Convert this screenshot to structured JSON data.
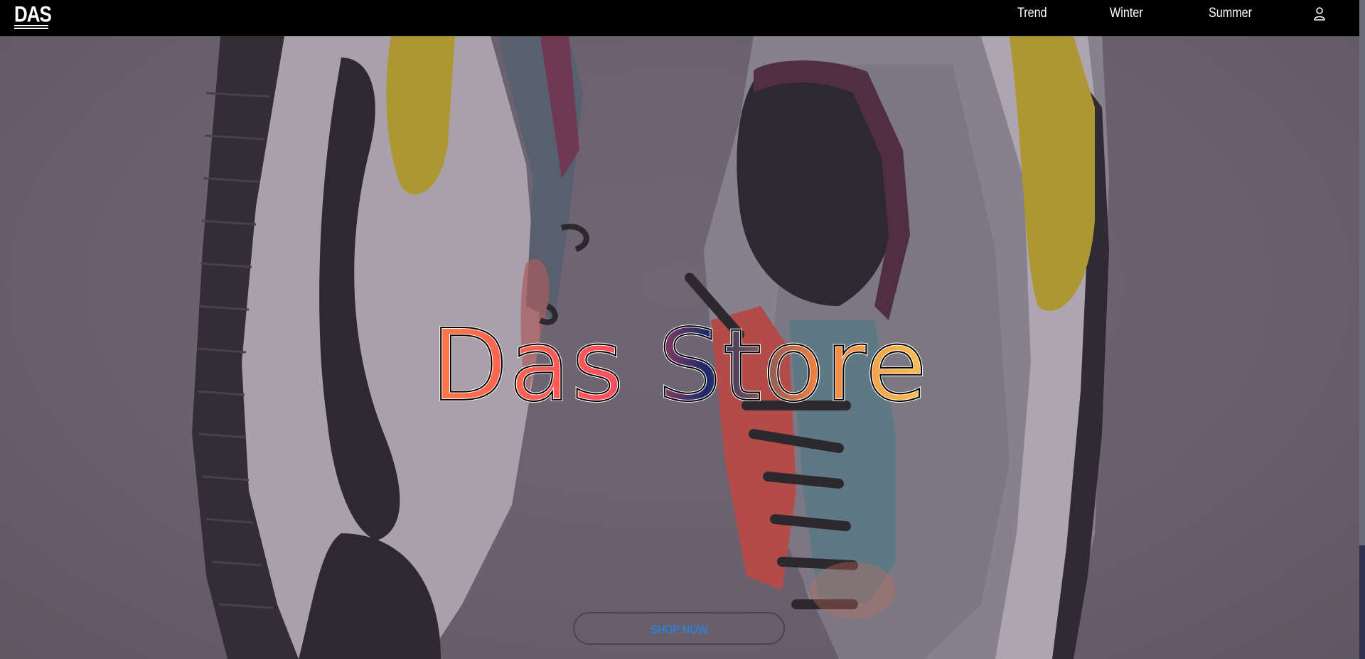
{
  "nav": {
    "logo_text": "DAS",
    "links": [
      {
        "label": "Trend"
      },
      {
        "label": "Winter"
      },
      {
        "label": "Summer"
      }
    ],
    "user_icon": "user-icon"
  },
  "hero": {
    "title": "Das Store",
    "cta_label": "SHOP NOW"
  },
  "colors": {
    "navbar_bg": "#000000",
    "cta_text": "#1e88ff",
    "overlay": "#6f6672"
  }
}
